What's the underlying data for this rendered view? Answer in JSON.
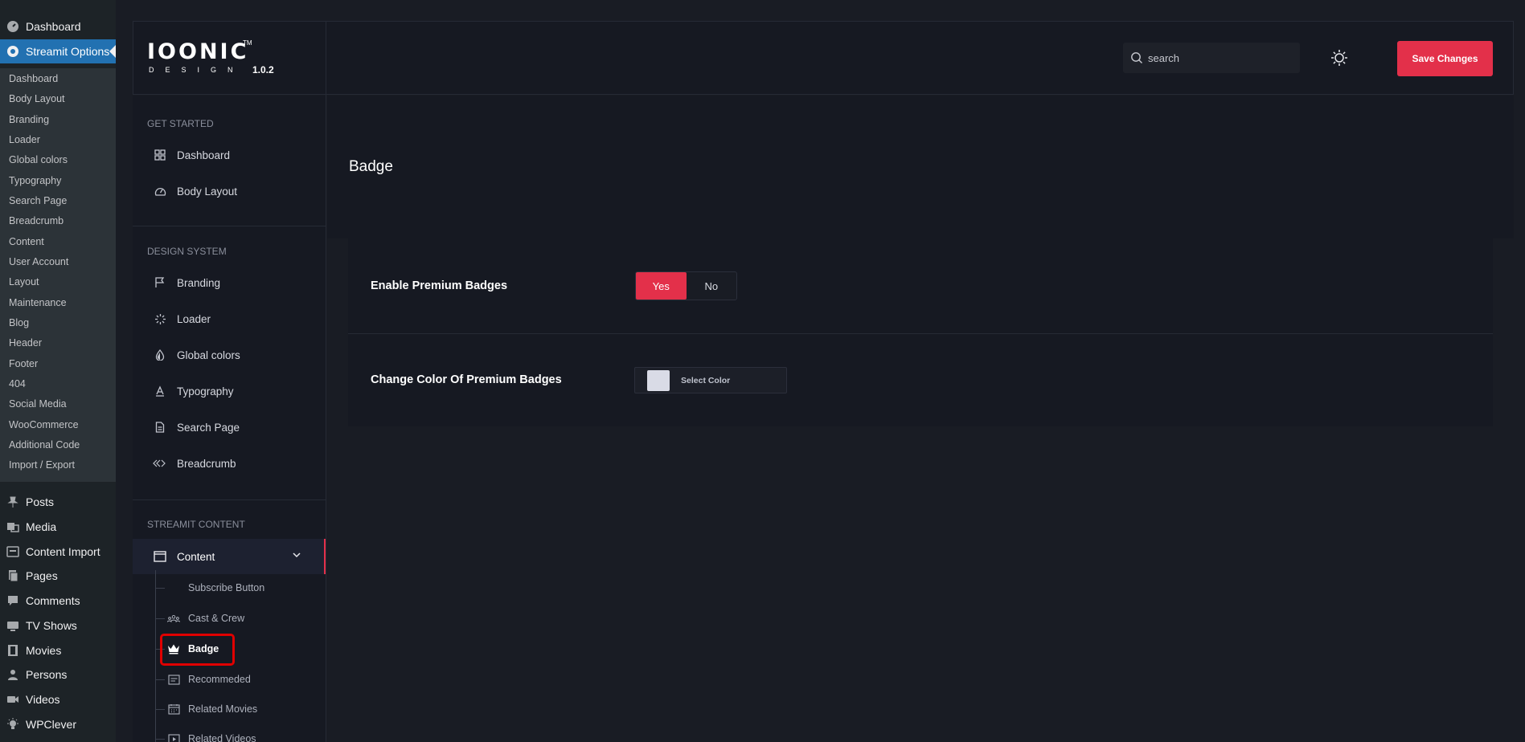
{
  "wp_menu": {
    "top_items": [
      {
        "label": "Dashboard",
        "icon": "gauge-icon"
      },
      {
        "label": "Streamit Options",
        "icon": "streamit-icon"
      }
    ],
    "sub_items": [
      "Dashboard",
      "Body Layout",
      "Branding",
      "Loader",
      "Global colors",
      "Typography",
      "Search Page",
      "Breadcrumb",
      "Content",
      "User Account",
      "Layout",
      "Maintenance",
      "Blog",
      "Header",
      "Footer",
      "404",
      "Social Media",
      "WooCommerce",
      "Additional Code",
      "Import / Export"
    ],
    "bottom_items": [
      {
        "label": "Posts",
        "icon": "pin-icon"
      },
      {
        "label": "Media",
        "icon": "media-icon"
      },
      {
        "label": "Content Import",
        "icon": "import-icon"
      },
      {
        "label": "Pages",
        "icon": "pages-icon"
      },
      {
        "label": "Comments",
        "icon": "comment-icon"
      },
      {
        "label": "TV Shows",
        "icon": "tv-icon"
      },
      {
        "label": "Movies",
        "icon": "film-icon"
      },
      {
        "label": "Persons",
        "icon": "person-icon"
      },
      {
        "label": "Videos",
        "icon": "video-icon"
      },
      {
        "label": "WPClever",
        "icon": "bulb-icon"
      }
    ]
  },
  "topbar": {
    "logo_main": "IOONIC",
    "logo_tm": "TM",
    "logo_sub": "DESIGN",
    "version": "1.0.2",
    "search_placeholder": "search",
    "save_label": "Save Changes"
  },
  "options_nav": {
    "get_started_label": "GET STARTED",
    "get_started": [
      {
        "label": "Dashboard",
        "icon": "grid-icon"
      },
      {
        "label": "Body Layout",
        "icon": "speedometer-icon"
      }
    ],
    "design_system_label": "DESIGN SYSTEM",
    "design_system": [
      {
        "label": "Branding",
        "icon": "flag-icon"
      },
      {
        "label": "Loader",
        "icon": "loader-icon"
      },
      {
        "label": "Global colors",
        "icon": "droplet-icon"
      },
      {
        "label": "Typography",
        "icon": "typography-icon"
      },
      {
        "label": "Search Page",
        "icon": "document-icon"
      },
      {
        "label": "Breadcrumb",
        "icon": "breadcrumb-icon"
      }
    ],
    "streamit_content_label": "STREAMIT CONTENT",
    "content_group": {
      "label": "Content",
      "icon": "window-icon"
    },
    "content_children": [
      {
        "label": "Subscribe Button",
        "icon": ""
      },
      {
        "label": "Cast & Crew",
        "icon": "people-icon"
      },
      {
        "label": "Badge",
        "icon": "crown-icon"
      },
      {
        "label": "Recommeded",
        "icon": "card-icon"
      },
      {
        "label": "Related Movies",
        "icon": "calendar-icon"
      },
      {
        "label": "Related Videos",
        "icon": "play-icon"
      }
    ]
  },
  "page": {
    "title": "Badge",
    "fields": {
      "enable_label": "Enable Premium Badges",
      "yes_label": "Yes",
      "no_label": "No",
      "color_label": "Change Color Of Premium Badges",
      "select_color_label": "Select Color",
      "swatch_color": "#d9dbe6"
    }
  },
  "colors": {
    "accent": "#e3304a",
    "wp_active": "#2271b1",
    "highlight": "#e00000"
  }
}
